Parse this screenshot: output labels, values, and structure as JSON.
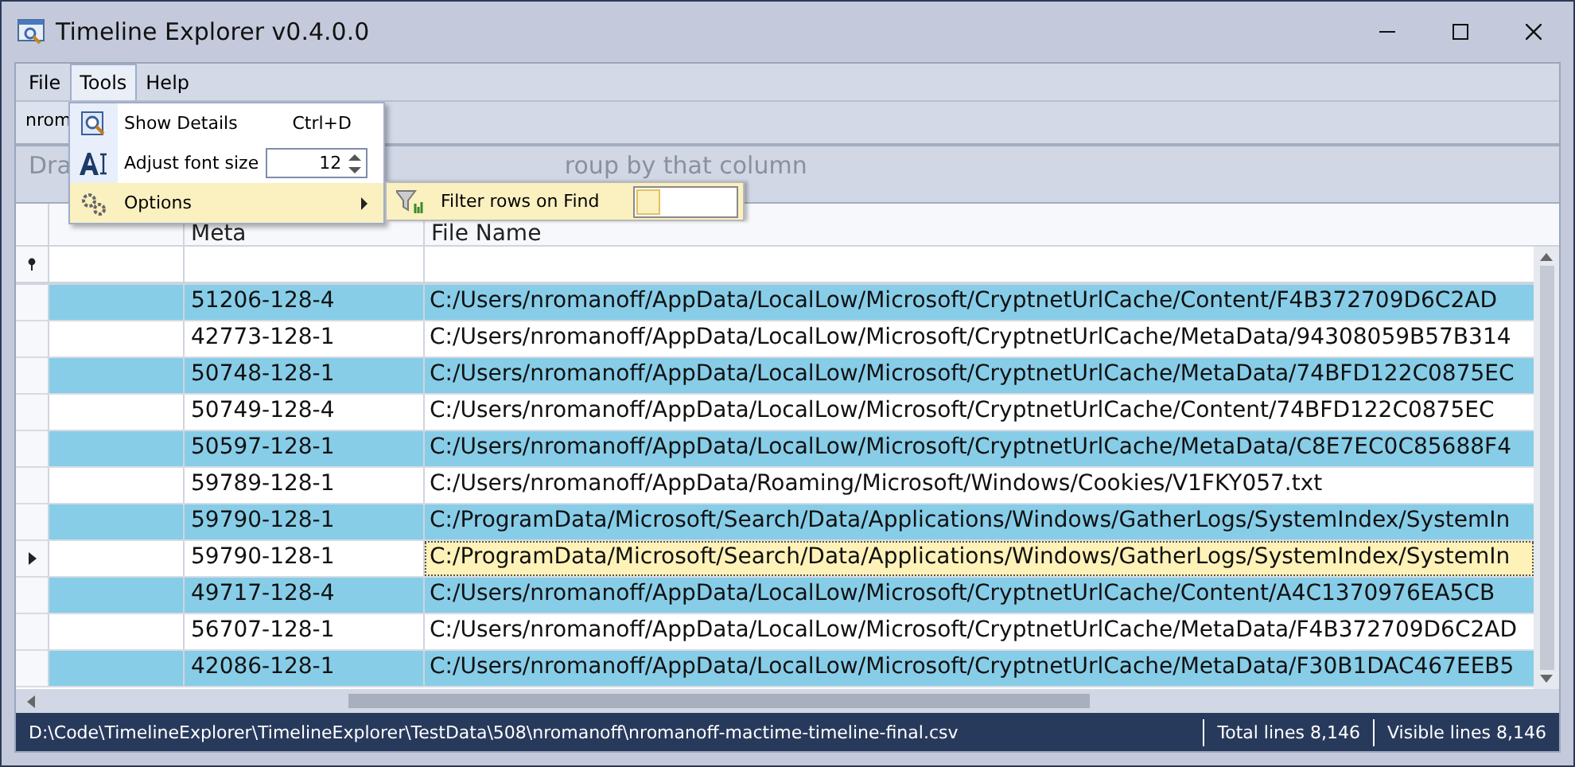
{
  "window": {
    "title": "Timeline Explorer v0.4.0.0"
  },
  "menu_bar": [
    {
      "label": "File",
      "selected": false
    },
    {
      "label": "Tools",
      "selected": true
    },
    {
      "label": "Help",
      "selected": false
    }
  ],
  "tabs": [
    "nrom"
  ],
  "group_panel": {
    "hint_start": "Dra",
    "hint_end": "roup by that column"
  },
  "columns": [
    "Meta",
    "File Name"
  ],
  "rows": [
    {
      "meta": "51206-128-4",
      "file_name": "C:/Users/nromanoff/AppData/LocalLow/Microsoft/CryptnetUrlCache/Content/F4B372709D6C2AD",
      "current": false
    },
    {
      "meta": "42773-128-1",
      "file_name": "C:/Users/nromanoff/AppData/LocalLow/Microsoft/CryptnetUrlCache/MetaData/94308059B57B314",
      "current": false
    },
    {
      "meta": "50748-128-1",
      "file_name": "C:/Users/nromanoff/AppData/LocalLow/Microsoft/CryptnetUrlCache/MetaData/74BFD122C0875EC",
      "current": false
    },
    {
      "meta": "50749-128-4",
      "file_name": "C:/Users/nromanoff/AppData/LocalLow/Microsoft/CryptnetUrlCache/Content/74BFD122C0875EC",
      "current": false
    },
    {
      "meta": "50597-128-1",
      "file_name": "C:/Users/nromanoff/AppData/LocalLow/Microsoft/CryptnetUrlCache/MetaData/C8E7EC0C85688F4",
      "current": false
    },
    {
      "meta": "59789-128-1",
      "file_name": "C:/Users/nromanoff/AppData/Roaming/Microsoft/Windows/Cookies/V1FKY057.txt",
      "current": false
    },
    {
      "meta": "59790-128-1",
      "file_name": "C:/ProgramData/Microsoft/Search/Data/Applications/Windows/GatherLogs/SystemIndex/SystemIn",
      "current": false
    },
    {
      "meta": "59790-128-1",
      "file_name": "C:/ProgramData/Microsoft/Search/Data/Applications/Windows/GatherLogs/SystemIndex/SystemIn",
      "current": true
    },
    {
      "meta": "49717-128-4",
      "file_name": "C:/Users/nromanoff/AppData/LocalLow/Microsoft/CryptnetUrlCache/Content/A4C1370976EA5CB",
      "current": false
    },
    {
      "meta": "56707-128-1",
      "file_name": "C:/Users/nromanoff/AppData/LocalLow/Microsoft/CryptnetUrlCache/MetaData/F4B372709D6C2AD",
      "current": false
    },
    {
      "meta": "42086-128-1",
      "file_name": "C:/Users/nromanoff/AppData/LocalLow/Microsoft/CryptnetUrlCache/MetaData/F30B1DAC467EEB5",
      "current": false
    }
  ],
  "tools_menu": [
    {
      "kind": "command",
      "label": "Show Details",
      "shortcut": "Ctrl+D",
      "highlighted": false
    },
    {
      "kind": "spinner",
      "label": "Adjust font size",
      "value": "12",
      "highlighted": false
    },
    {
      "kind": "submenu",
      "label": "Options",
      "highlighted": true
    }
  ],
  "options_submenu": [
    {
      "label": "Filter rows on Find",
      "checked": false
    }
  ],
  "status_bar": {
    "path": "D:\\Code\\TimelineExplorer\\TimelineExplorer\\TestData\\508\\nromanoff\\nromanoff-mactime-timeline-final.csv",
    "total": "Total lines 8,146",
    "visible": "Visible lines 8,146"
  }
}
